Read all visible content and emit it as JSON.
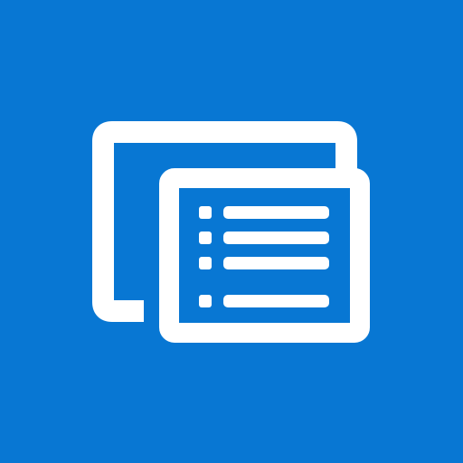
{
  "icon": {
    "name": "windows-list-icon",
    "background_color": "#0877d3",
    "foreground_color": "#ffffff",
    "list_rows": 4
  }
}
